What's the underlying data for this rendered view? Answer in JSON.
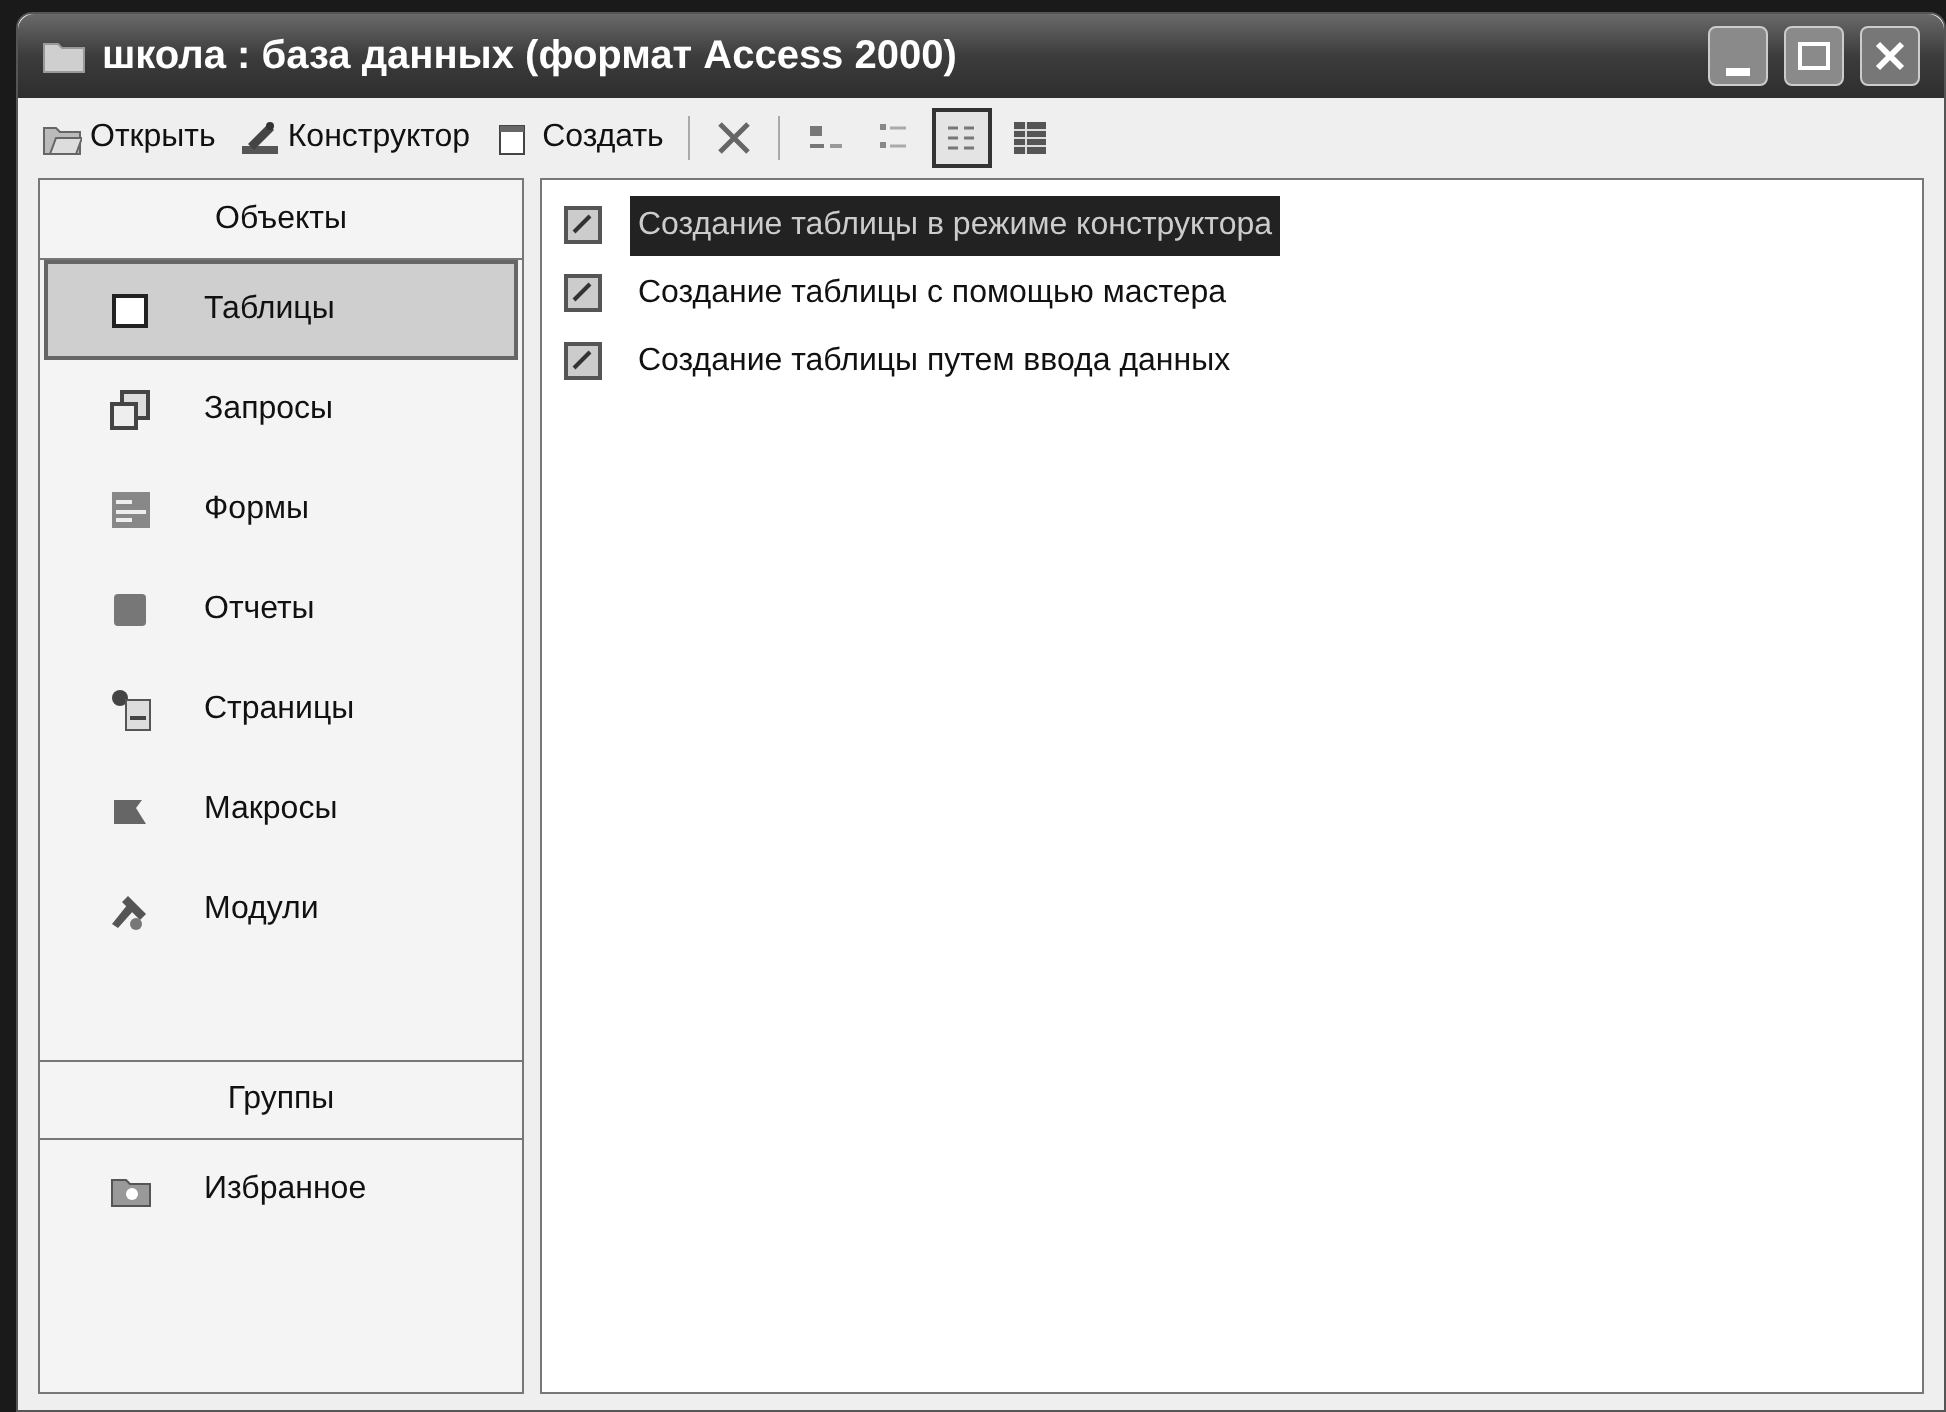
{
  "window": {
    "title": "школа : база данных (формат Access 2000)"
  },
  "toolbar": {
    "buttons": [
      {
        "kind": "open",
        "label": "Открыть"
      },
      {
        "kind": "design",
        "label": "Конструктор"
      },
      {
        "kind": "new",
        "label": "Создать"
      }
    ],
    "views": [
      {
        "kind": "large",
        "selected": false
      },
      {
        "kind": "small",
        "selected": false
      },
      {
        "kind": "list",
        "selected": true
      },
      {
        "kind": "details",
        "selected": false
      }
    ]
  },
  "sidebar": {
    "sections": [
      {
        "title": "Объекты",
        "items": [
          {
            "kind": "tables",
            "label": "Таблицы",
            "selected": true
          },
          {
            "kind": "queries",
            "label": "Запросы",
            "selected": false
          },
          {
            "kind": "forms",
            "label": "Формы",
            "selected": false
          },
          {
            "kind": "reports",
            "label": "Отчеты",
            "selected": false
          },
          {
            "kind": "pages",
            "label": "Страницы",
            "selected": false
          },
          {
            "kind": "macros",
            "label": "Макросы",
            "selected": false
          },
          {
            "kind": "modules",
            "label": "Модули",
            "selected": false
          }
        ]
      },
      {
        "title": "Группы",
        "items": [
          {
            "kind": "favorites",
            "label": "Избранное",
            "selected": false
          }
        ]
      }
    ]
  },
  "list": {
    "items": [
      {
        "label": "Создание таблицы в режиме конструктора",
        "selected": true
      },
      {
        "label": "Создание таблицы с помощью мастера",
        "selected": false
      },
      {
        "label": "Создание таблицы путем ввода данных",
        "selected": false
      }
    ]
  }
}
